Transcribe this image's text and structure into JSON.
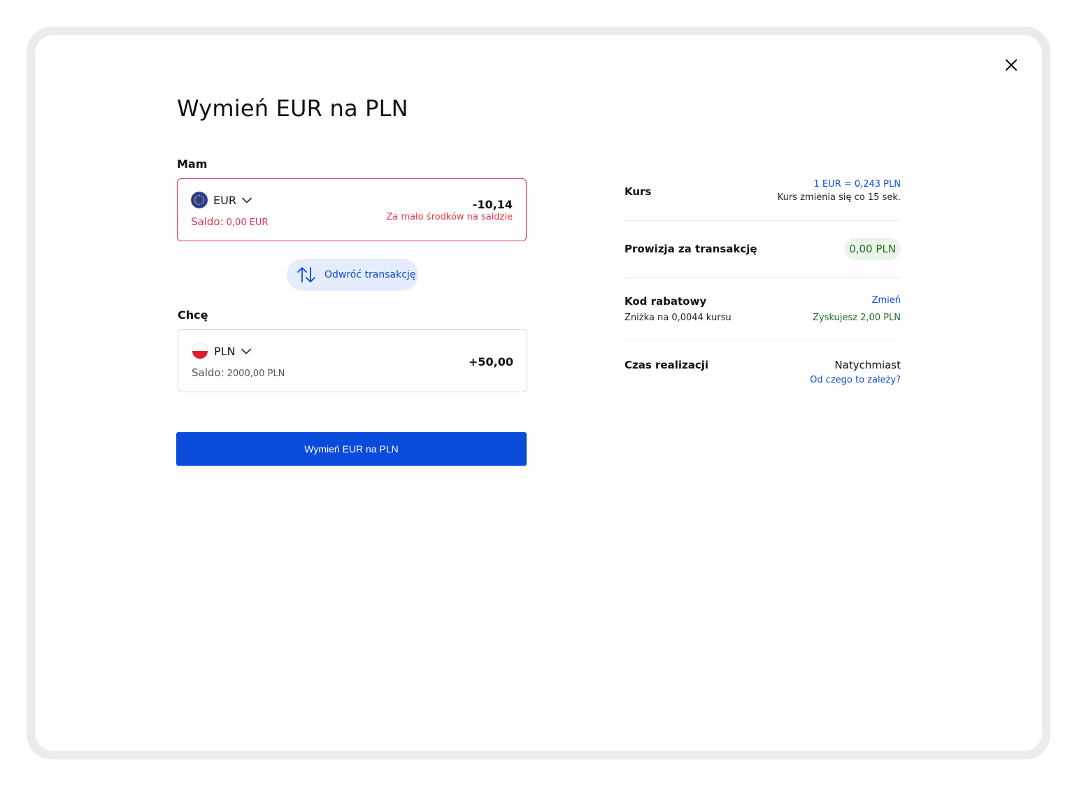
{
  "modal": {
    "title": "Wymień EUR na PLN",
    "close_label": "close"
  },
  "have": {
    "label": "Mam",
    "currency": "EUR",
    "saldo_label": "Saldo:",
    "saldo_value": "0,00 EUR",
    "amount": "-10,14",
    "error": "Za mało środków na saldzie"
  },
  "swap": {
    "label": "Odwróć transakcję"
  },
  "want": {
    "label": "Chcę",
    "currency": "PLN",
    "saldo_label": "Saldo:",
    "saldo_value": "2000,00 PLN",
    "amount": "+50,00"
  },
  "submit": {
    "label": "Wymień EUR na PLN"
  },
  "details": {
    "rate": {
      "label": "Kurs",
      "value": "1 EUR = 0,243 PLN",
      "note": "Kurs zmienia się co 15 sek."
    },
    "fee": {
      "label": "Prowizja za transakcję",
      "value": "0,00 PLN"
    },
    "discount": {
      "label": "Kod rabatowy",
      "change_link": "Zmień",
      "desc": "Zniżka na 0,0044 kursu",
      "gain": "Zyskujesz 2,00 PLN"
    },
    "time": {
      "label": "Czas realizacji",
      "value": "Natychmiast",
      "link": "Od czego to zależy?"
    }
  },
  "colors": {
    "primary": "#0b4bdb",
    "error": "#e0364b",
    "success": "#1f6b26",
    "swap_bg": "#e5edfd",
    "fee_bg": "#eaf5ea"
  },
  "icons": {
    "close": "close-icon",
    "swap": "swap-arrows-icon",
    "chevron": "chevron-down-icon",
    "eur_flag": "eu-flag-icon",
    "pln_flag": "pl-flag-icon"
  }
}
